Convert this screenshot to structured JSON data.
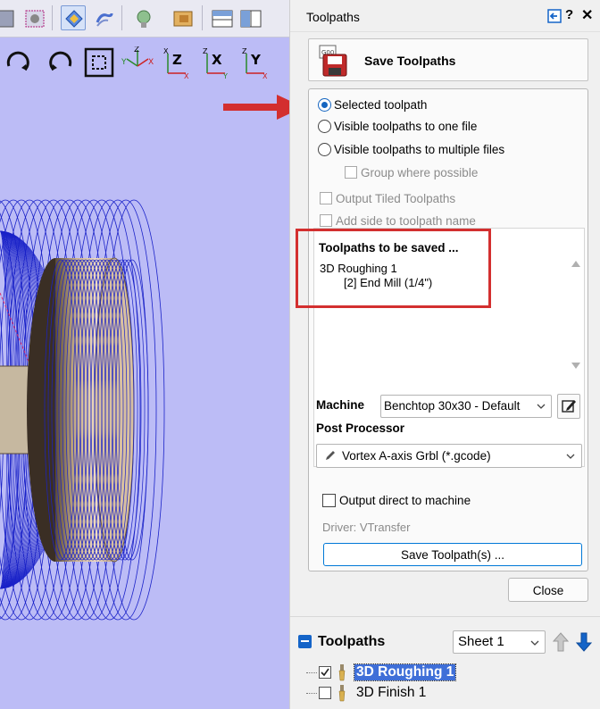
{
  "panel": {
    "title": "Toolpaths",
    "help": "?",
    "close_glyph": "✕",
    "pin_icon": "pin-icon"
  },
  "save_header": {
    "label": "Save Toolpaths",
    "icon": "floppy-disk-icon"
  },
  "options": {
    "selected_toolpath": "Selected toolpath",
    "visible_one_file": "Visible toolpaths to one file",
    "visible_multiple_files": "Visible toolpaths to multiple files",
    "group_where_possible": "Group where possible",
    "output_tiled": "Output Tiled Toolpaths",
    "add_side": "Add side to toolpath name",
    "selected_option": "selected_toolpath"
  },
  "saved_list": {
    "title": "Toolpaths to be saved ...",
    "items": [
      "3D Roughing 1",
      "[2] End Mill (1/4\")"
    ]
  },
  "machine": {
    "label": "Machine",
    "value": "Benchtop 30x30 - Default"
  },
  "post_processor": {
    "label": "Post Processor",
    "value": "Vortex A-axis Grbl (*.gcode)"
  },
  "output_direct": {
    "label": "Output direct to machine",
    "checked": false
  },
  "driver": "Driver: VTransfer",
  "buttons": {
    "save_toolpaths": "Save Toolpath(s) ...",
    "close": "Close"
  },
  "toolpath_tree": {
    "title": "Toolpaths",
    "sheet": "Sheet 1",
    "items": [
      {
        "label": "3D Roughing 1",
        "checked": true,
        "selected": true
      },
      {
        "label": "3D Finish 1",
        "checked": false,
        "selected": false
      }
    ]
  },
  "view_toolbar": {
    "axis_labels": [
      "Z",
      "X",
      "Y",
      "Z",
      "X",
      "Y"
    ]
  },
  "colors": {
    "annotation_red": "#d32f2f",
    "accent_blue": "#1565c0",
    "viewport_bg": "#bcbcf6",
    "toolpath_blue": "#1a22c8"
  }
}
